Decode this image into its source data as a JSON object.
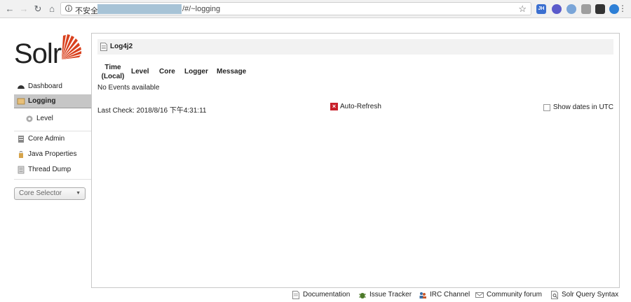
{
  "browser": {
    "security_label": "不安全",
    "url_path": "/#/~logging",
    "extensions": [
      "JH"
    ]
  },
  "logo": {
    "text": "Solr"
  },
  "sidebar": {
    "items": [
      {
        "label": "Dashboard",
        "icon": "dashboard-icon"
      },
      {
        "label": "Logging",
        "icon": "logging-icon",
        "active": true
      },
      {
        "label": "Level",
        "icon": "gear-icon",
        "sub": true
      },
      {
        "label": "Core Admin",
        "icon": "core-admin-icon"
      },
      {
        "label": "Java Properties",
        "icon": "java-icon"
      },
      {
        "label": "Thread Dump",
        "icon": "thread-dump-icon"
      }
    ],
    "core_selector": "Core Selector"
  },
  "main": {
    "title": "Log4j2",
    "columns": [
      "Time\n(Local)",
      "Level",
      "Core",
      "Logger",
      "Message"
    ],
    "empty": "No Events available",
    "last_check": "Last Check: 2018/8/16 下午4:31:11",
    "auto_refresh": "Auto-Refresh",
    "show_utc": "Show dates in UTC",
    "colors": {
      "accent_red": "#c8202a",
      "logo_red": "#d9411e"
    }
  },
  "footer": {
    "links": [
      "Documentation",
      "Issue Tracker",
      "IRC Channel",
      "Community forum",
      "Solr Query Syntax"
    ]
  }
}
